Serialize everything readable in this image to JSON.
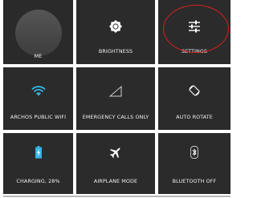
{
  "tiles": {
    "me": {
      "label": "ME"
    },
    "brightness": {
      "label": "BRIGHTNESS"
    },
    "settings": {
      "label": "SETTINGS"
    },
    "wifi": {
      "label": "ARCHOS PUBLIC WIFI"
    },
    "signal": {
      "label": "EMERGENCY CALLS ONLY"
    },
    "rotate": {
      "label": "AUTO ROTATE"
    },
    "battery": {
      "label": "CHARGING, 28%",
      "level_percent": 28
    },
    "airplane": {
      "label": "AIRPLANE MODE"
    },
    "bluetooth": {
      "label": "BLUETOOTH OFF"
    }
  },
  "colors": {
    "tile_background": "#2b2b2b",
    "accent_blue": "#33b5e5",
    "highlight_red": "#d82020",
    "label_text": "#f0f0f0"
  },
  "icons": [
    "brightness-icon",
    "settings-sliders-icon",
    "wifi-icon",
    "signal-icon",
    "auto-rotate-icon",
    "battery-charging-icon",
    "airplane-icon",
    "bluetooth-icon"
  ]
}
